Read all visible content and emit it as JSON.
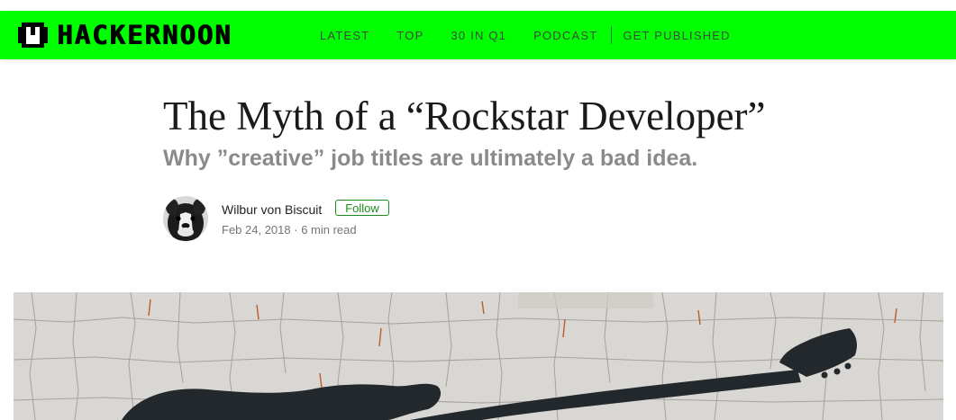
{
  "brand": {
    "name": "HACKERNOON",
    "color": "#00ff00"
  },
  "nav": {
    "items": [
      "LATEST",
      "TOP",
      "30 IN Q1",
      "PODCAST",
      "GET PUBLISHED"
    ]
  },
  "article": {
    "title": "The Myth of a “Rockstar Developer”",
    "subtitle": "Why ”creative” job titles are ultimately a bad idea.",
    "author": "Wilbur von Biscuit",
    "follow_label": "Follow",
    "date": "Feb 24, 2018",
    "separator": " · ",
    "read_time": "6 min read"
  },
  "hero": {
    "description_icon": "guitar-silhouette-image"
  }
}
